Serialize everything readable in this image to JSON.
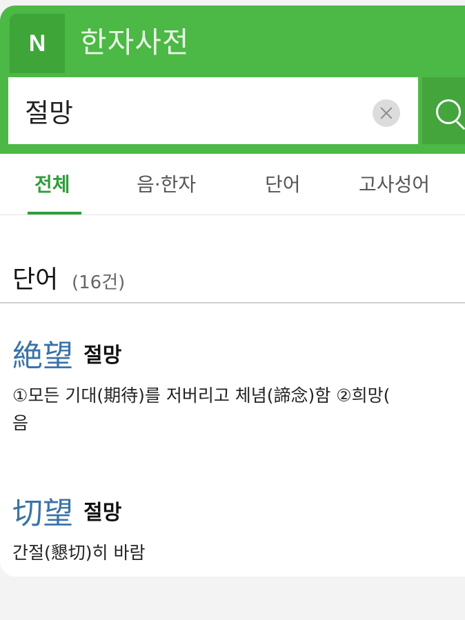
{
  "header": {
    "logo_letter": "N",
    "title": "한자사전"
  },
  "search": {
    "value": "절망",
    "placeholder": ""
  },
  "tabs": [
    {
      "label": "전체",
      "active": true
    },
    {
      "label": "음·한자",
      "active": false
    },
    {
      "label": "단어",
      "active": false
    },
    {
      "label": "고사성어",
      "active": false
    }
  ],
  "section": {
    "title": "단어",
    "count": "(16건)"
  },
  "entries": [
    {
      "hanja": "絶望",
      "reading": "절망",
      "meaning_line1": "①모든 기대(期待)를 저버리고 체념(諦念)함    ②희망(",
      "meaning_line2": "음"
    },
    {
      "hanja": "切望",
      "reading": "절망",
      "meaning_line1": "간절(懇切)히 바람"
    }
  ],
  "colors": {
    "brand_green": "#4cb845",
    "active_tab": "#2e9e3a",
    "hanja_blue": "#3a73a8"
  }
}
